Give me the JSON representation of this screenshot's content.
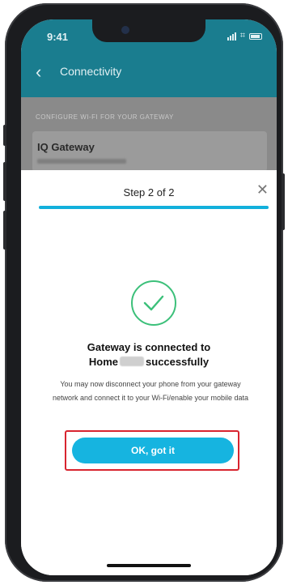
{
  "status_bar": {
    "time": "9:41"
  },
  "header": {
    "title": "Connectivity",
    "back_icon": "chevron-left-icon"
  },
  "background_page": {
    "section_label": "CONFIGURE WI-FI FOR YOUR GATEWAY",
    "gateway_name": "IQ Gateway"
  },
  "modal": {
    "step_title": "Step 2 of 2",
    "close_icon": "close-icon",
    "progress": 1.0,
    "success_icon": "check-circle-icon",
    "title_line1": "Gateway is connected to",
    "title_line2_start": "Home",
    "title_line2_end": "successfully",
    "body": "You may now disconnect your phone from your gateway network and connect it to your Wi-Fi/enable your mobile data",
    "ok_button": "OK, got it"
  },
  "colors": {
    "header_teal": "#1a7d8f",
    "accent_blue": "#16b4e0",
    "success_green": "#3cc07a",
    "highlight_red": "#d8242f"
  }
}
